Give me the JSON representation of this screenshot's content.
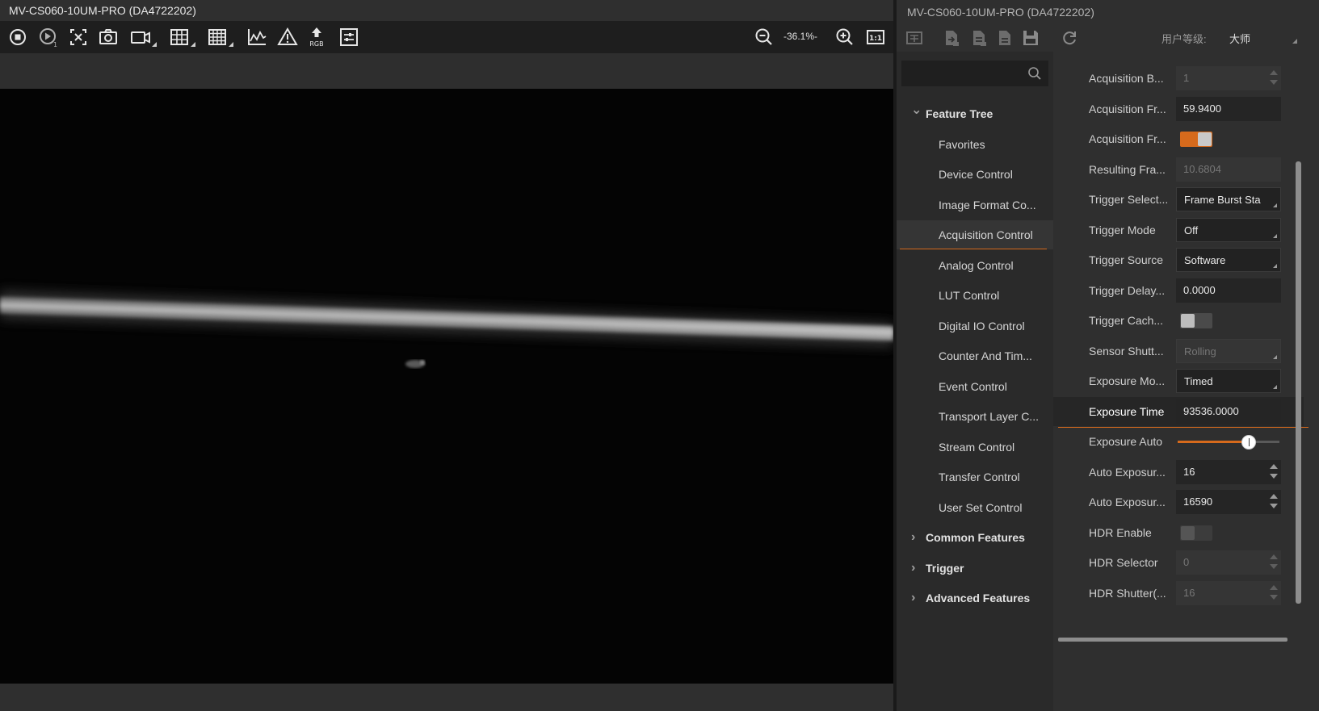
{
  "left": {
    "title": "MV-CS060-10UM-PRO (DA4722202)",
    "toolbar": {
      "tools": [
        {
          "icon": "stop-icon"
        },
        {
          "icon": "play-step-icon"
        },
        {
          "icon": "close-capture-icon"
        },
        {
          "icon": "snapshot-camera-icon"
        },
        {
          "icon": "record-video-icon"
        },
        {
          "icon": "grid-small-icon"
        },
        {
          "icon": "grid-large-icon"
        },
        {
          "icon": "histogram-icon"
        },
        {
          "icon": "warning-icon"
        },
        {
          "icon": "rgb-export-icon",
          "label": "RGB"
        },
        {
          "icon": "settings-sliders-icon"
        }
      ],
      "zoom_out_icon": "zoom-out-icon",
      "zoom_value": "-36.1%-",
      "zoom_in_icon": "zoom-in-icon",
      "actual_size_label": "1:1"
    }
  },
  "right": {
    "title": "MV-CS060-10UM-PRO (DA4722202)",
    "toolbar": {
      "icons": [
        "device-info-icon",
        "import-icon",
        "export-icon",
        "document-icon",
        "save-icon",
        "refresh-icon"
      ],
      "user_level_label": "用户等级:",
      "user_level_value": "大师"
    },
    "search": {
      "placeholder": ""
    },
    "tree": [
      {
        "type": "cat",
        "label": "Feature Tree",
        "expanded": true
      },
      {
        "type": "child",
        "label": "Favorites"
      },
      {
        "type": "child",
        "label": "Device Control"
      },
      {
        "type": "child",
        "label": "Image Format Co..."
      },
      {
        "type": "child",
        "label": "Acquisition Control",
        "active": true
      },
      {
        "type": "child",
        "label": "Analog Control"
      },
      {
        "type": "child",
        "label": "LUT Control"
      },
      {
        "type": "child",
        "label": "Digital IO Control"
      },
      {
        "type": "child",
        "label": "Counter And Tim..."
      },
      {
        "type": "child",
        "label": "Event Control"
      },
      {
        "type": "child",
        "label": "Transport Layer C..."
      },
      {
        "type": "child",
        "label": "Stream Control"
      },
      {
        "type": "child",
        "label": "Transfer Control"
      },
      {
        "type": "child",
        "label": "User Set Control"
      },
      {
        "type": "cat",
        "label": "Common Features",
        "expanded": false
      },
      {
        "type": "cat",
        "label": "Trigger",
        "expanded": false
      },
      {
        "type": "cat",
        "label": "Advanced Features",
        "expanded": false
      }
    ],
    "properties": [
      {
        "name": "Acquisition B...",
        "kind": "spin",
        "value": "1",
        "disabled": true
      },
      {
        "name": "Acquisition Fr...",
        "kind": "text",
        "value": "59.9400"
      },
      {
        "name": "Acquisition Fr...",
        "kind": "toggle",
        "on": true
      },
      {
        "name": "Resulting Fra...",
        "kind": "text",
        "value": "10.6804",
        "disabled": true
      },
      {
        "name": "Trigger Select...",
        "kind": "combo",
        "value": "Frame Burst Sta"
      },
      {
        "name": "Trigger Mode",
        "kind": "combo",
        "value": "Off"
      },
      {
        "name": "Trigger Source",
        "kind": "combo",
        "value": "Software"
      },
      {
        "name": "Trigger Delay...",
        "kind": "text",
        "value": "0.0000"
      },
      {
        "name": "Trigger Cach...",
        "kind": "toggle",
        "on": false
      },
      {
        "name": "Sensor Shutt...",
        "kind": "combo",
        "value": "Rolling",
        "disabled": true
      },
      {
        "name": "Exposure Mo...",
        "kind": "combo",
        "value": "Timed"
      },
      {
        "name": "Exposure Time",
        "kind": "text",
        "value": "93536.0000",
        "active": true
      },
      {
        "name": "Exposure Auto",
        "kind": "slider",
        "fraction": 0.7
      },
      {
        "name": "Auto Exposur...",
        "kind": "spin",
        "value": "16"
      },
      {
        "name": "Auto Exposur...",
        "kind": "spin",
        "value": "16590"
      },
      {
        "name": "HDR Enable",
        "kind": "toggle",
        "on": false,
        "disabled": true
      },
      {
        "name": "HDR Selector",
        "kind": "spin",
        "value": "0",
        "disabled": true
      },
      {
        "name": "HDR Shutter(...",
        "kind": "spin",
        "value": "16",
        "disabled": true
      }
    ]
  },
  "colors": {
    "accent": "#d66a1c",
    "panel": "#2f2f2f",
    "image_bg": "#040404"
  }
}
